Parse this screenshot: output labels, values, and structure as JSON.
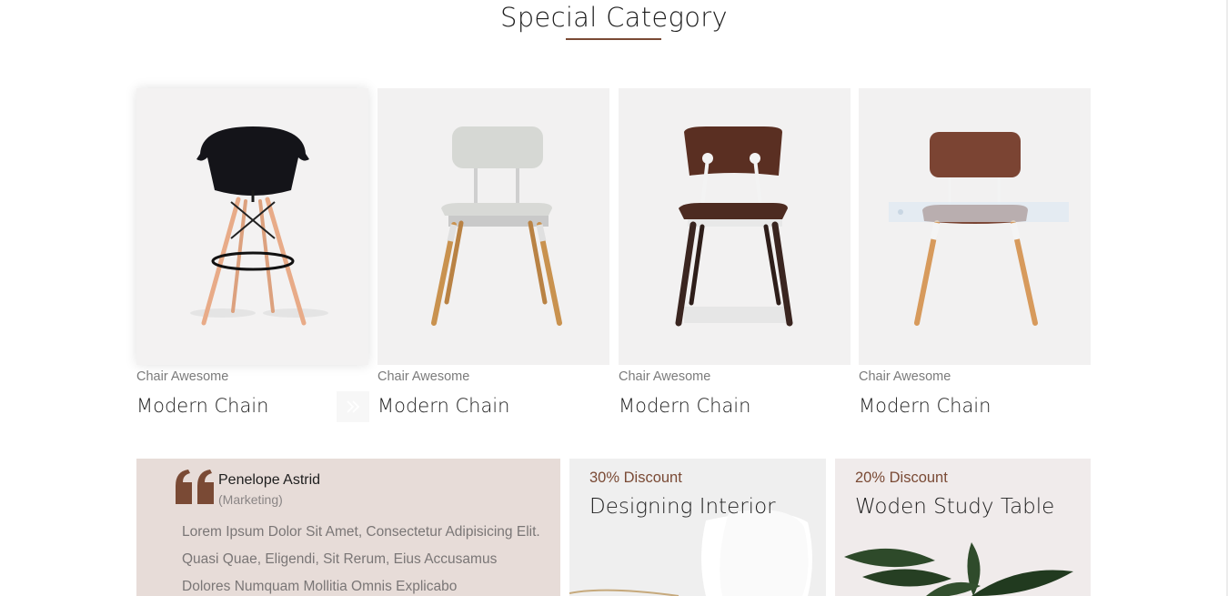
{
  "section": {
    "title": "Special Category"
  },
  "products": [
    {
      "subtitle": "Chair Awesome",
      "name": "Modern Chain"
    },
    {
      "subtitle": "Chair Awesome",
      "name": "Modern Chain"
    },
    {
      "subtitle": "Chair Awesome",
      "name": "Modern Chain"
    },
    {
      "subtitle": "Chair Awesome",
      "name": "Modern Chain"
    }
  ],
  "testimonial": {
    "name": "Penelope Astrid",
    "role": "(Marketing)",
    "text": "Lorem Ipsum Dolor Sit Amet, Consectetur Adipisicing Elit. Quasi Quae, Eligendi, Sit Rerum, Eius Accusamus Dolores Numquam Mollitia Omnis Explicabo"
  },
  "promos": [
    {
      "discount": "30% Discount",
      "title": "Designing Interior"
    },
    {
      "discount": "20% Discount",
      "title": "Woden Study Table"
    }
  ],
  "colors": {
    "accent": "#7a4a35",
    "card_bg": "#f2f1f1",
    "testimonial_bg": "#e7dcd8"
  },
  "icons": {
    "quote": "quote-icon",
    "arrow": "double-chevron-right-icon"
  }
}
